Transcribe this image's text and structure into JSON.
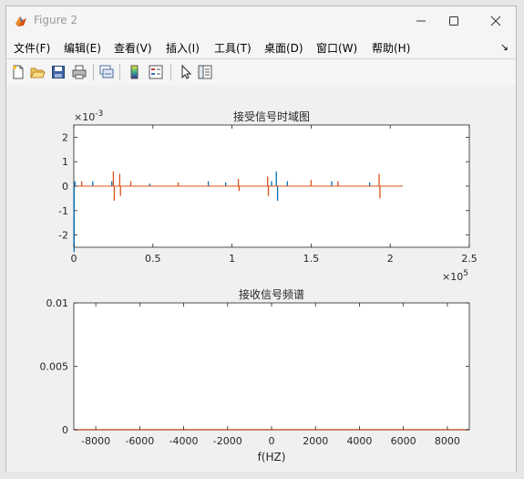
{
  "window": {
    "title": "Figure 2"
  },
  "menu": [
    "文件(F)",
    "编辑(E)",
    "查看(V)",
    "插入(I)",
    "工具(T)",
    "桌面(D)",
    "窗口(W)",
    "帮助(H)"
  ],
  "toolbar": [
    "new-figure-icon",
    "open-icon",
    "save-icon",
    "print-icon",
    "link-plot-icon",
    "colorbar-icon",
    "legend-icon",
    "pointer-icon",
    "property-inspector-icon"
  ],
  "colors": {
    "series1": "#0072BD",
    "series2": "#D95319",
    "plot_bg": "#ffffff",
    "axis": "#262626"
  },
  "chart_data": [
    {
      "type": "line",
      "title": "接受信号时域图",
      "xlabel": "",
      "ylabel": "",
      "xlim": [
        0,
        250000
      ],
      "ylim": [
        -0.0025,
        0.0025
      ],
      "x_exponent_label": "×10",
      "x_exponent_power": "5",
      "y_exponent_label": "×10",
      "y_exponent_power": "-3",
      "xticks": [
        0,
        50000,
        100000,
        150000,
        200000,
        250000
      ],
      "xtick_labels": [
        "0",
        "0.5",
        "1",
        "1.5",
        "2",
        "2.5"
      ],
      "yticks": [
        -0.002,
        -0.001,
        0,
        0.001,
        0.002
      ],
      "ytick_labels": [
        "-2",
        "-1",
        "0",
        "1",
        "2"
      ],
      "grid": false,
      "series": [
        {
          "color": "#0072BD",
          "signal_end": 208000,
          "spikes": [
            {
              "x": 200,
              "amp": -0.0027
            },
            {
              "x": 700,
              "amp": 0.0002
            },
            {
              "x": 12000,
              "amp": 0.0002
            },
            {
              "x": 24000,
              "amp": 0.0002
            },
            {
              "x": 48000,
              "amp": 0.0001
            },
            {
              "x": 85000,
              "amp": 0.0002
            },
            {
              "x": 96000,
              "amp": 0.00015
            },
            {
              "x": 125000,
              "amp": 0.0002
            },
            {
              "x": 128000,
              "amp": 0.0006
            },
            {
              "x": 128800,
              "amp": -0.0006
            },
            {
              "x": 135000,
              "amp": 0.0002
            },
            {
              "x": 163000,
              "amp": 0.0002
            },
            {
              "x": 187000,
              "amp": 0.00015
            }
          ]
        },
        {
          "color": "#D95319",
          "signal_end": 208000,
          "spikes": [
            {
              "x": 5000,
              "amp": 0.0002
            },
            {
              "x": 25000,
              "amp": 0.0006
            },
            {
              "x": 25600,
              "amp": -0.0006
            },
            {
              "x": 29000,
              "amp": 0.0005
            },
            {
              "x": 29500,
              "amp": -0.0004
            },
            {
              "x": 36000,
              "amp": 0.0002
            },
            {
              "x": 66000,
              "amp": 0.00015
            },
            {
              "x": 104000,
              "amp": 0.0003
            },
            {
              "x": 104500,
              "amp": -0.0002
            },
            {
              "x": 122500,
              "amp": 0.0004
            },
            {
              "x": 123000,
              "amp": -0.0004
            },
            {
              "x": 150000,
              "amp": 0.00025
            },
            {
              "x": 167000,
              "amp": 0.0002
            },
            {
              "x": 193000,
              "amp": 0.0005
            },
            {
              "x": 193500,
              "amp": -0.0005
            }
          ]
        }
      ]
    },
    {
      "type": "line",
      "title": "接收信号频谱",
      "xlabel": "f(HZ)",
      "ylabel": "",
      "xlim": [
        -9000,
        9000
      ],
      "ylim": [
        0,
        0.01
      ],
      "xticks": [
        -8000,
        -6000,
        -4000,
        -2000,
        0,
        2000,
        4000,
        6000,
        8000
      ],
      "xtick_labels": [
        "-8000",
        "-6000",
        "-4000",
        "-2000",
        "0",
        "2000",
        "4000",
        "6000",
        "8000"
      ],
      "yticks": [
        0,
        0.005,
        0.01
      ],
      "ytick_labels": [
        "0",
        "0.005",
        "0.01"
      ],
      "grid": false,
      "series": [
        {
          "color": "#0072BD",
          "x": [
            -9000,
            9000
          ],
          "y": [
            0,
            0
          ]
        },
        {
          "color": "#D95319",
          "x": [
            -9000,
            9000
          ],
          "y": [
            0,
            0
          ]
        }
      ]
    }
  ]
}
